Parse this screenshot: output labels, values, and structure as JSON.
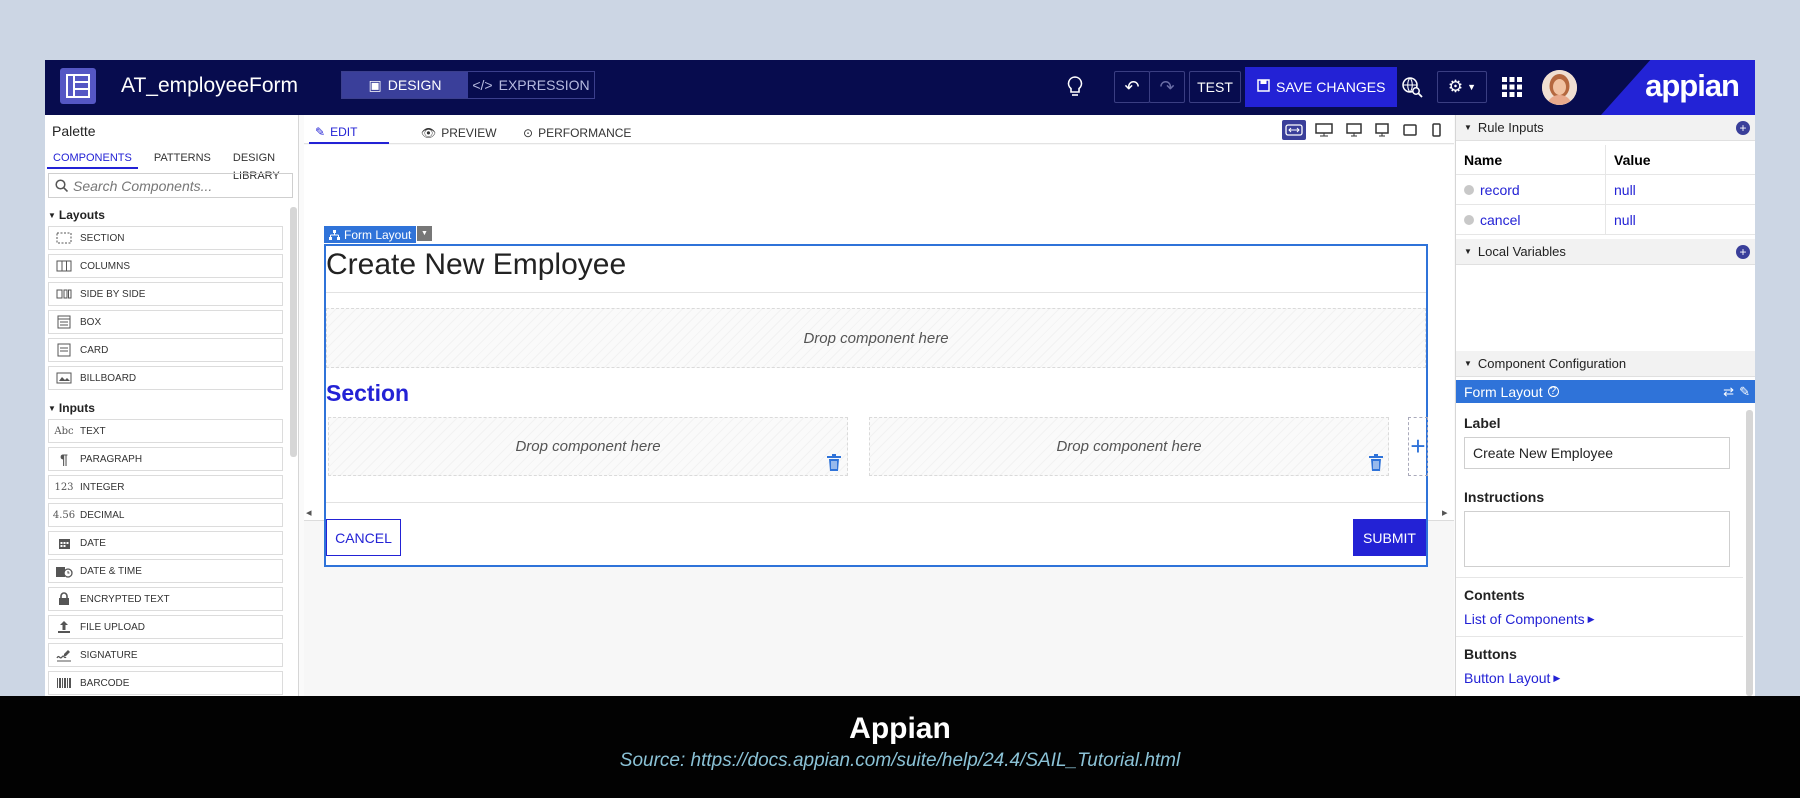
{
  "header": {
    "app_title": "AT_employeeForm",
    "mode_design": "DESIGN",
    "mode_expression": "EXPRESSION",
    "test_label": "TEST",
    "save_label": "SAVE CHANGES",
    "brand": "appian"
  },
  "palette": {
    "title": "Palette",
    "tabs": [
      "COMPONENTS",
      "PATTERNS",
      "DESIGN LIBRARY"
    ],
    "search_placeholder": "Search Components...",
    "groups": [
      {
        "label": "Layouts",
        "items": [
          "SECTION",
          "COLUMNS",
          "SIDE BY SIDE",
          "BOX",
          "CARD",
          "BILLBOARD"
        ]
      },
      {
        "label": "Inputs",
        "items": [
          "TEXT",
          "PARAGRAPH",
          "INTEGER",
          "DECIMAL",
          "DATE",
          "DATE & TIME",
          "ENCRYPTED TEXT",
          "FILE UPLOAD",
          "SIGNATURE",
          "BARCODE"
        ]
      }
    ],
    "icon_text": {
      "text": "Abc",
      "integer": "123",
      "decimal": "4.56"
    }
  },
  "canvas": {
    "tabs": [
      "EDIT",
      "PREVIEW",
      "PERFORMANCE"
    ],
    "form_layout_label": "Form Layout",
    "form_title": "Create New Employee",
    "drop_text": "Drop component here",
    "section_title": "Section",
    "cancel_label": "CANCEL",
    "submit_label": "SUBMIT"
  },
  "right_panel": {
    "rule_inputs_title": "Rule Inputs",
    "col_name": "Name",
    "col_value": "Value",
    "rule_inputs": [
      {
        "name": "record",
        "value": "null"
      },
      {
        "name": "cancel",
        "value": "null"
      }
    ],
    "local_variables_title": "Local Variables",
    "component_config_title": "Component Configuration",
    "selected_component": "Form Layout",
    "label_heading": "Label",
    "label_value": "Create New Employee",
    "instructions_heading": "Instructions",
    "contents_heading": "Contents",
    "contents_link": "List of Components",
    "buttons_heading": "Buttons",
    "buttons_link": "Button Layout"
  },
  "footer": {
    "title": "Appian",
    "source": "Source: https://docs.appian.com/suite/help/24.4/SAIL_Tutorial.html"
  }
}
